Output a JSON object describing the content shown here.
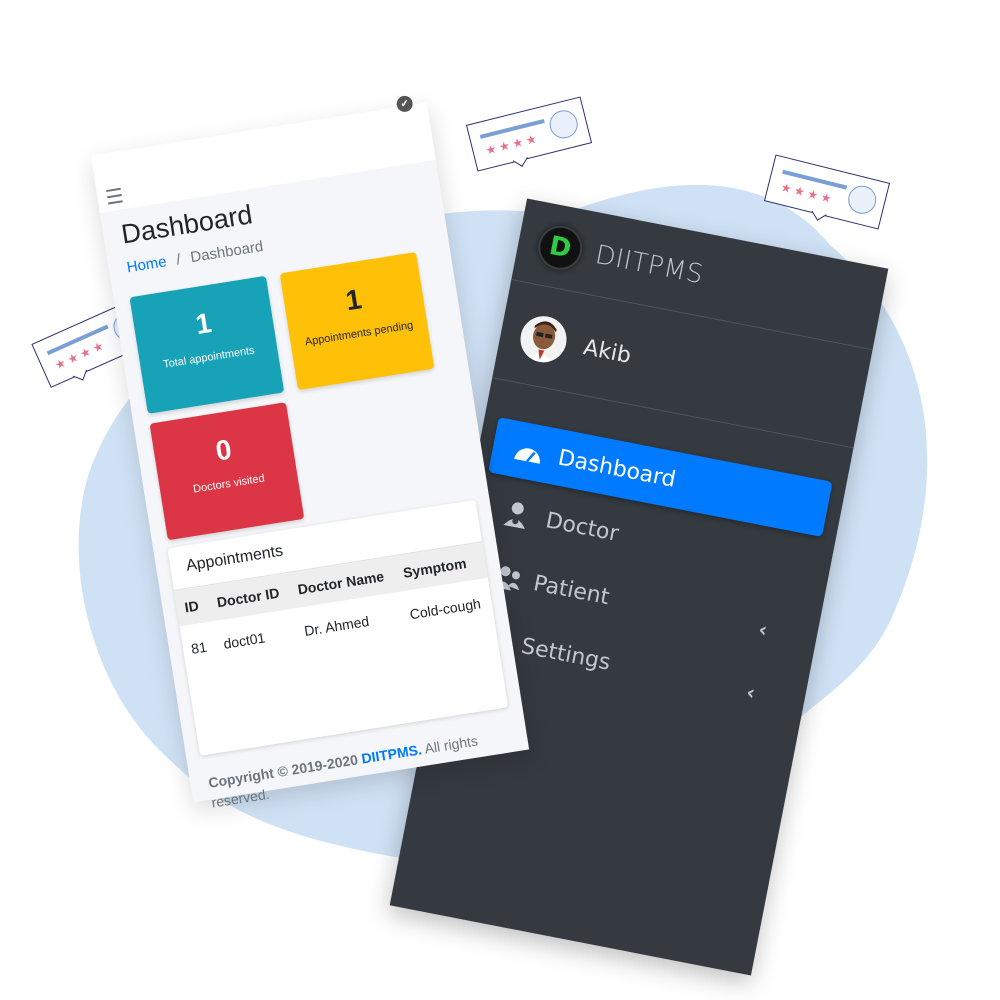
{
  "sidebar": {
    "brand_letter": "D",
    "brand_name": "DIITPMS",
    "user_name": "Akib",
    "items": [
      {
        "label": "Dashboard",
        "icon": "tachometer-icon",
        "active": true
      },
      {
        "label": "Doctor",
        "icon": "user-md-icon",
        "active": false
      },
      {
        "label": "Patient",
        "icon": "users-icon",
        "active": false,
        "expandable": true
      },
      {
        "label": "Settings",
        "icon": "cogs-icon",
        "active": false,
        "expandable": true
      }
    ]
  },
  "dashboard": {
    "title": "Dashboard",
    "breadcrumb": {
      "home": "Home",
      "separator": "/",
      "current": "Dashboard"
    },
    "stats": [
      {
        "value": "1",
        "label": "Total appointments",
        "color": "#17a2b8"
      },
      {
        "value": "1",
        "label": "Appointments pending",
        "color": "#ffc107"
      },
      {
        "value": "0",
        "label": "Doctors visited",
        "color": "#dc3545"
      }
    ],
    "appointments": {
      "title": "Appointments",
      "columns": [
        "ID",
        "Doctor ID",
        "Doctor Name",
        "Symptom"
      ],
      "rows": [
        [
          "81",
          "doct01",
          "Dr. Ahmed",
          "Cold-cough"
        ]
      ]
    },
    "footer": {
      "copyright": "Copyright © 2019-2020",
      "brand": "DIITPMS.",
      "rest": "All rights reserved."
    }
  },
  "colors": {
    "primary": "#007bff",
    "sidebar_bg": "#343a40",
    "blob": "#cfe2f5"
  }
}
